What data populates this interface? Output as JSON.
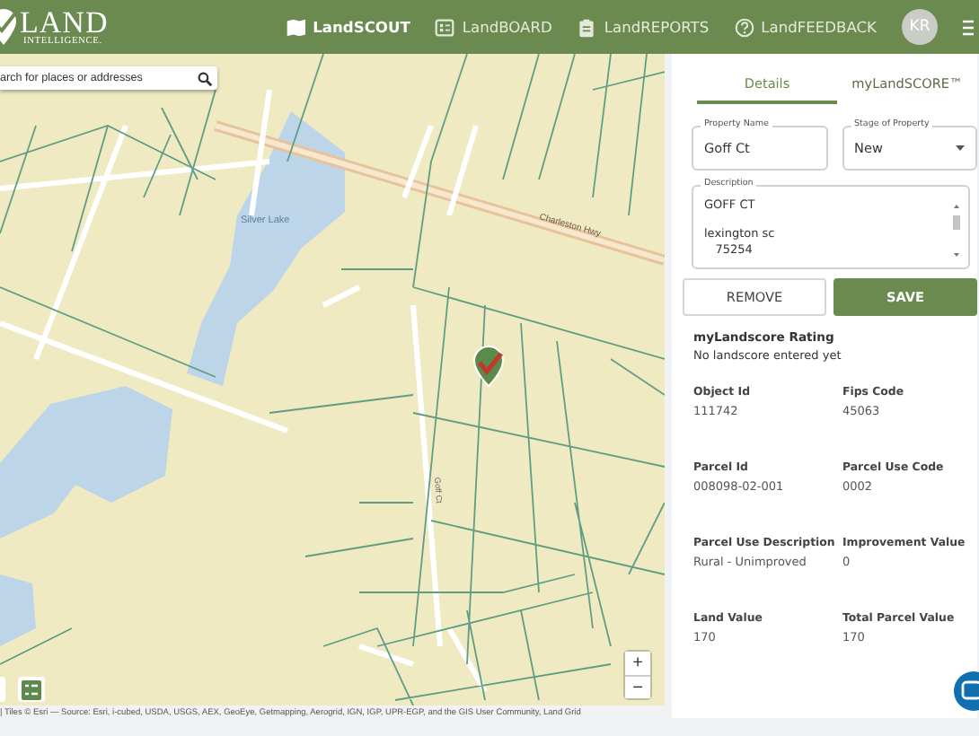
{
  "header": {
    "logo": {
      "name": "LAND",
      "tagline": "INTELLIGENCE."
    },
    "nav": [
      {
        "label": "LandSCOUT",
        "kind": "map",
        "selected": true
      },
      {
        "label": "LandBOARD",
        "kind": "board",
        "selected": false
      },
      {
        "label": "LandREPORTS",
        "kind": "clipboard",
        "selected": false
      },
      {
        "label": "LandFEEDBACK",
        "kind": "help",
        "selected": false
      }
    ],
    "avatar": "KR"
  },
  "map": {
    "search": {
      "placeholder": "arch for places or addresses"
    },
    "labels": [
      {
        "text": "Silver Lake",
        "kind": "water"
      },
      {
        "text": "Charleston Hwy",
        "kind": "highway"
      },
      {
        "text": "Goff Ct",
        "kind": "street"
      }
    ],
    "zoom": [
      "+",
      "−"
    ],
    "attribution": "| Tiles © Esri — Source: Esri, i-cubed, USDA, USGS, AEX, GeoEye, Getmapping, Aerogrid, IGN, IGP, UPR-EGP, and the GIS User Community, Land Grid"
  },
  "panel": {
    "tabs": [
      {
        "label": "Details",
        "selected": true
      },
      {
        "label": "myLandSCORE™",
        "selected": false
      }
    ],
    "fields": [
      {
        "label": "Property Name",
        "value": "Goff Ct",
        "kind": "text"
      },
      {
        "label": "Stage of Property",
        "value": "New",
        "kind": "select"
      }
    ],
    "description": {
      "label": "Description",
      "value": "GOFF CT\n\nlexington sc\n   75254"
    },
    "buttons": [
      {
        "label": "REMOVE",
        "kind": "secondary"
      },
      {
        "label": "SAVE",
        "kind": "primary"
      }
    ],
    "rating": {
      "title": "myLandscore Rating",
      "text": "No landscore entered yet"
    },
    "properties": [
      {
        "label": "Object Id",
        "value": "111742"
      },
      {
        "label": "Fips Code",
        "value": "45063"
      },
      {
        "label": "Parcel Id",
        "value": "008098-02-001"
      },
      {
        "label": "Parcel Use Code",
        "value": "0002"
      },
      {
        "label": "Parcel Use Description",
        "value": "Rural - Unimproved"
      },
      {
        "label": "Improvement Value",
        "value": "0"
      },
      {
        "label": "Land Value",
        "value": "170"
      },
      {
        "label": "Total Parcel Value",
        "value": "170"
      }
    ]
  }
}
